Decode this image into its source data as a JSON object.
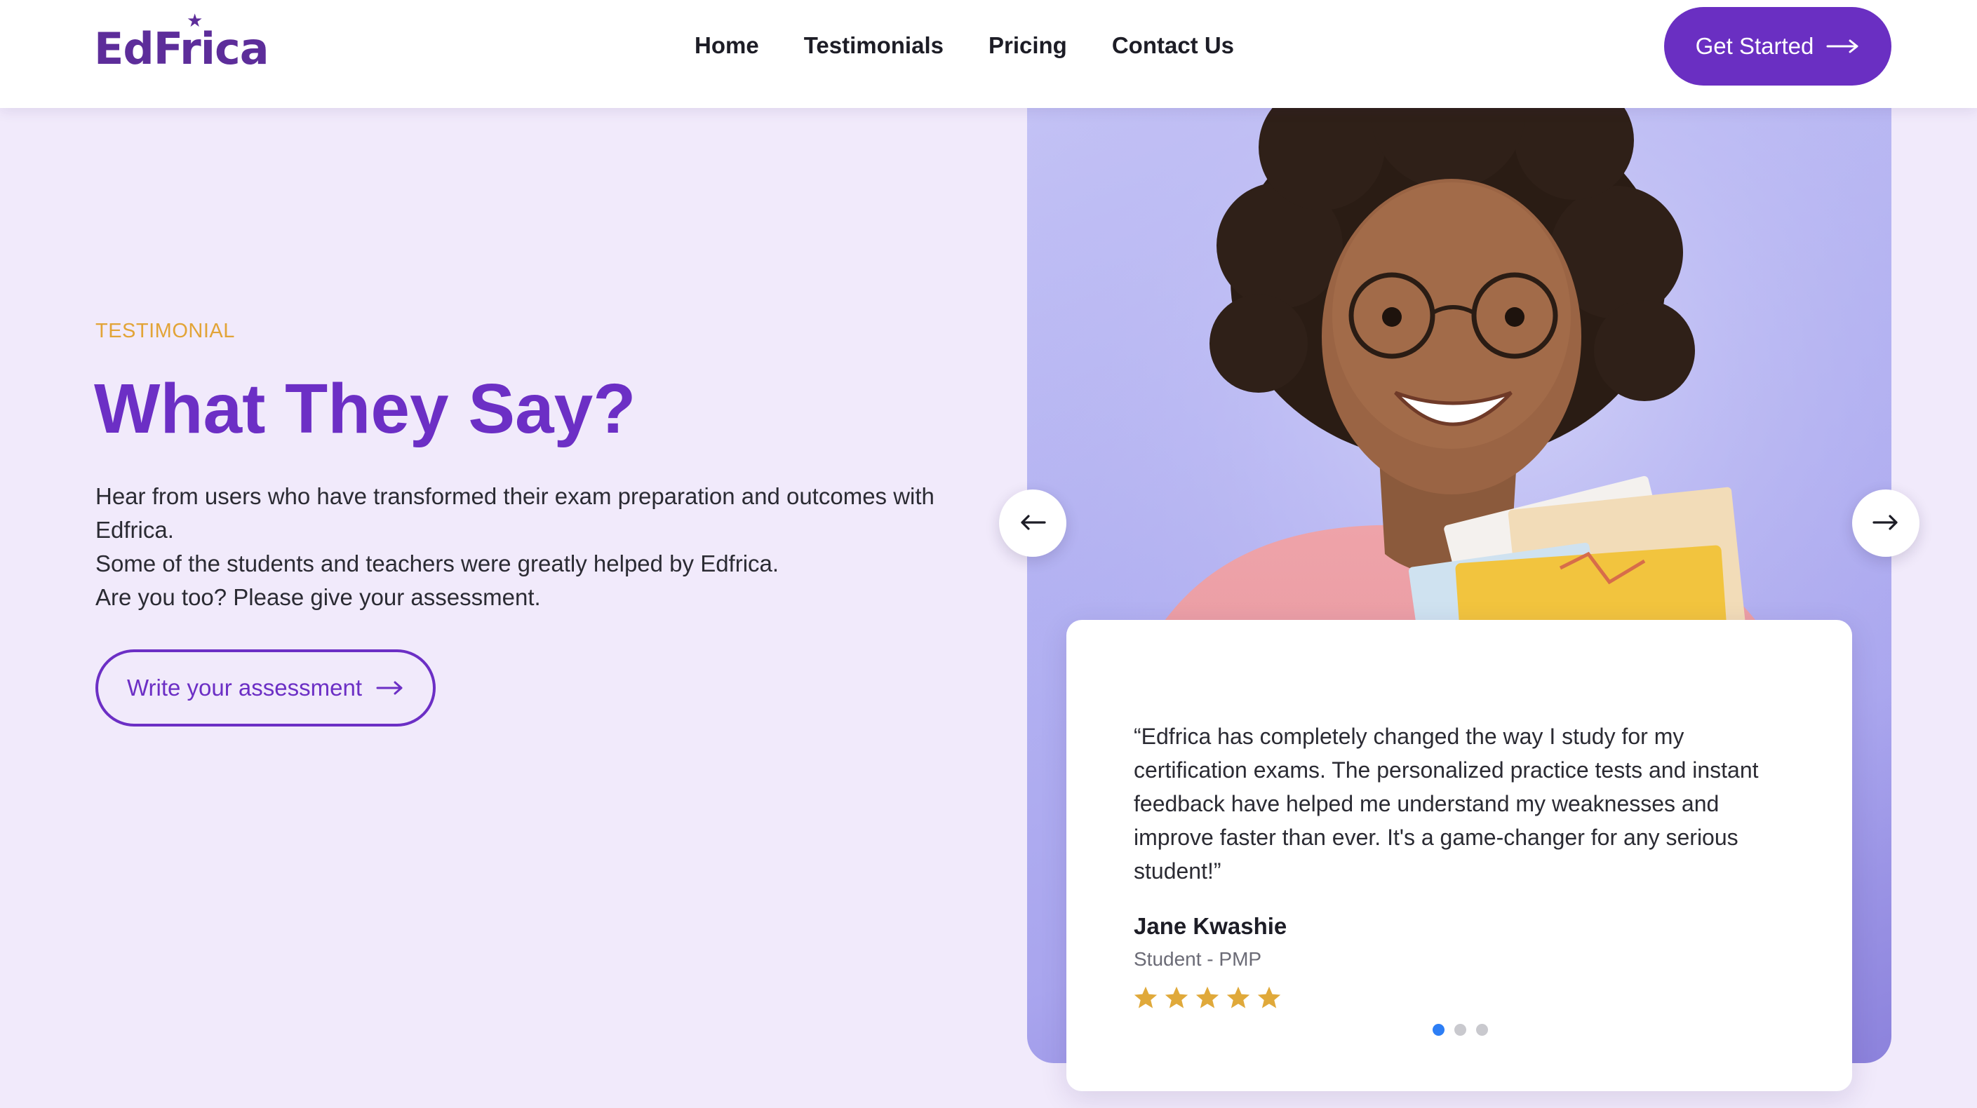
{
  "brand": {
    "name": "EdFrica",
    "color": "#5d2d9a",
    "accent": "#6c2fc5"
  },
  "nav": {
    "items": [
      "Home",
      "Testimonials",
      "Pricing",
      "Contact Us"
    ],
    "cta_label": "Get Started"
  },
  "hero": {
    "eyebrow": "TESTIMONIAL",
    "heading": "What They Say?",
    "lead_lines": [
      "Hear from users who have transformed their exam preparation and outcomes with Edfrica.",
      "Some of the students and teachers were greatly helped by Edfrica.",
      "Are you too? Please give your assessment."
    ],
    "button_label": "Write your assessment"
  },
  "testimonial": {
    "quote": "“Edfrica has completely changed the way I study for my certification exams. The personalized practice tests and instant feedback have helped me understand my weaknesses and improve faster than ever. It's a game-changer for any serious student!”",
    "author": "Jane Kwashie",
    "role": "Student - PMP",
    "rating": 5,
    "star_color": "#e0a93a"
  },
  "carousel": {
    "slide_count": 3,
    "active_index": 0,
    "active_dot_color": "#2d7ef5"
  },
  "icons": {
    "cta": "arrow-right-icon",
    "assessment": "arrow-right-icon",
    "prev": "arrow-left-icon",
    "next": "arrow-right-icon"
  }
}
